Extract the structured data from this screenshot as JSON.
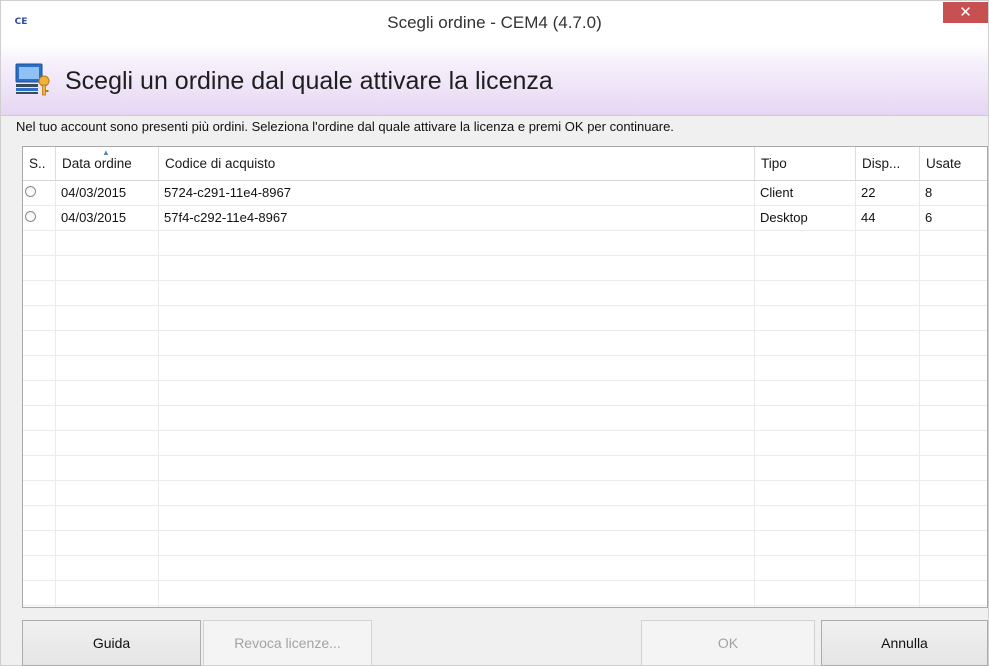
{
  "window": {
    "title": "Scegli ordine - CEM4 (4.7.0)",
    "app_icon": "CE",
    "close_glyph": "✕"
  },
  "header": {
    "icon": "computer-key-icon",
    "title": "Scegli un ordine dal quale attivare la licenza"
  },
  "instructions": "Nel tuo account sono presenti più ordini. Seleziona l'ordine dal quale attivare la licenza e premi OK per continuare.",
  "grid": {
    "columns": [
      "S..",
      "Data ordine",
      "Codice di acquisto",
      "Tipo",
      "Disp...",
      "Usate"
    ],
    "sorted_column": "Data ordine",
    "rows": [
      {
        "selected": false,
        "data": "04/03/2015",
        "codice": "5724-c291-11e4-8967",
        "tipo": "Client",
        "disp": "22",
        "usate": "8"
      },
      {
        "selected": false,
        "data": "04/03/2015",
        "codice": "57f4-c292-11e4-8967",
        "tipo": "Desktop",
        "disp": "44",
        "usate": "6"
      }
    ]
  },
  "buttons": {
    "help": "Guida",
    "revoke": "Revoca licenze...",
    "ok": "OK",
    "cancel": "Annulla"
  },
  "colors": {
    "close_button": "#c75050",
    "header_gradient_end": "#e6d6f3",
    "sort_arrow": "#5b84b8"
  }
}
